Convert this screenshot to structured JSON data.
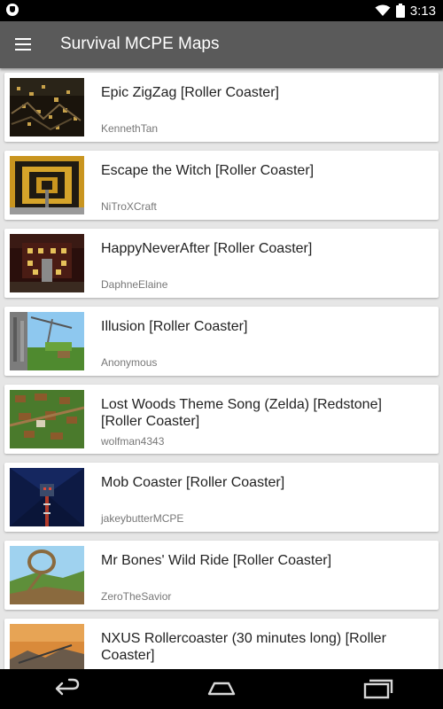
{
  "status_bar": {
    "time": "3:13",
    "icons": [
      "app-notification-icon",
      "wifi-icon",
      "battery-icon"
    ]
  },
  "app_bar": {
    "title": "Survival MCPE Maps",
    "menu_icon": "hamburger-menu-icon",
    "color": "#5a5a5a"
  },
  "maps": [
    {
      "title": "Epic ZigZag [Roller Coaster]",
      "author": "KennethTan"
    },
    {
      "title": "Escape the Witch [Roller Coaster]",
      "author": "NiTroXCraft"
    },
    {
      "title": "HappyNeverAfter [Roller Coaster]",
      "author": "DaphneElaine"
    },
    {
      "title": "Illusion [Roller Coaster]",
      "author": "Anonymous"
    },
    {
      "title": "Lost Woods Theme Song (Zelda) [Redstone] [Roller Coaster]",
      "author": "wolfman4343"
    },
    {
      "title": "Mob Coaster [Roller Coaster]",
      "author": "jakeybutterMCPE"
    },
    {
      "title": "Mr Bones' Wild Ride [Roller Coaster]",
      "author": "ZeroTheSavior"
    },
    {
      "title": "NXUS Rollercoaster (30 minutes long) [Roller Coaster]",
      "author": ""
    }
  ],
  "nav_bar": {
    "icons": [
      "back-icon",
      "home-icon",
      "recents-icon"
    ]
  }
}
